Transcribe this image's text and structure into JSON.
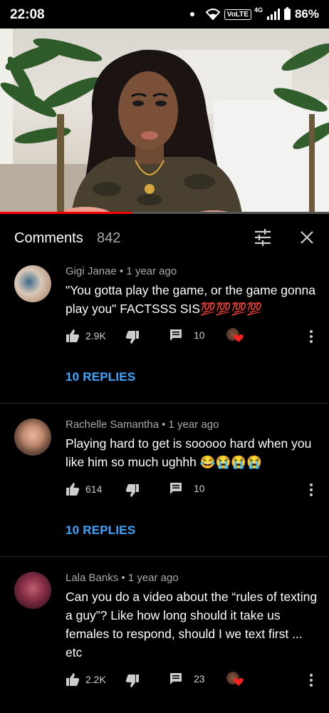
{
  "status_bar": {
    "time": "22:08",
    "network": "VoLTE",
    "network_gen": "4G",
    "battery": "86%"
  },
  "video": {
    "progress": 0.4
  },
  "comments_header": {
    "title": "Comments",
    "count": "842"
  },
  "comments": [
    {
      "author": "Gigi Janae",
      "time": "1 year ago",
      "text": "\"You gotta play the game, or the game gonna play you\" FACTSSS SIS💯💯💯💯",
      "likes": "2.9K",
      "reply_count": "10",
      "replies_label": "10 REPLIES",
      "creator_heart": true
    },
    {
      "author": "Rachelle Samantha",
      "time": "1 year ago",
      "text": "Playing hard to get is sooooo hard when you like him so much ughhh 😂😭😭😭",
      "likes": "614",
      "reply_count": "10",
      "replies_label": "10 REPLIES",
      "creator_heart": false
    },
    {
      "author": "Lala Banks",
      "time": "1 year ago",
      "text": "Can you do a video about the “rules of texting a guy”? Like how long should it take us females to respond, should I we text first ... etc",
      "likes": "2.2K",
      "reply_count": "23",
      "creator_heart": true
    }
  ],
  "separator": "•",
  "colors": {
    "accent": "#3ea6ff",
    "progress": "#ff0000",
    "background": "#000000"
  }
}
